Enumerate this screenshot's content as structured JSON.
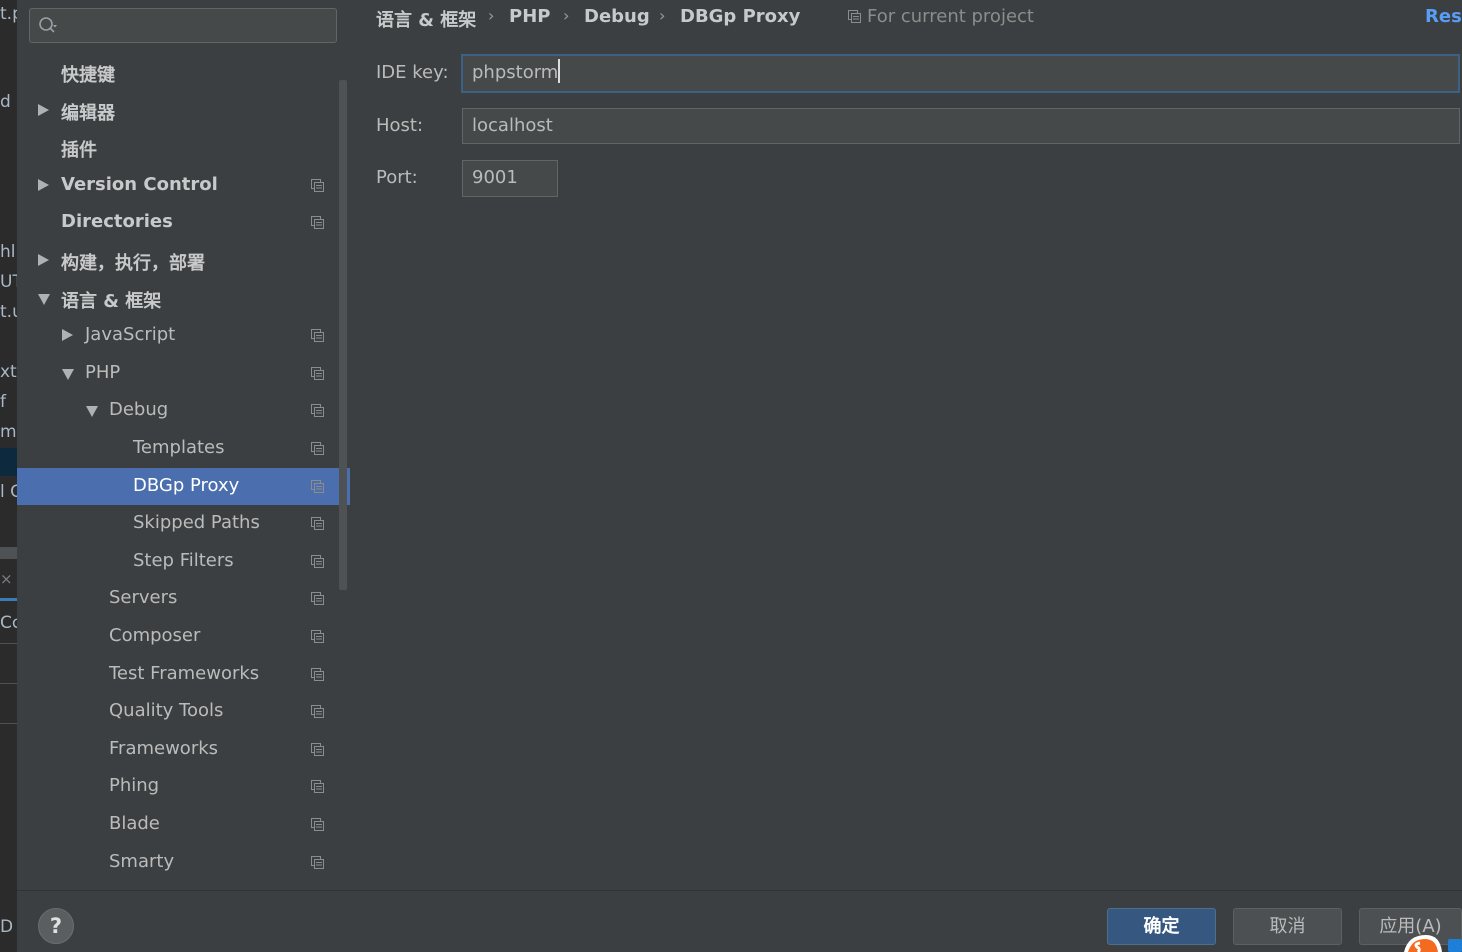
{
  "background_editor": {
    "fragments": [
      "t.p",
      "d",
      "hl",
      "UT",
      "t.u",
      "xt",
      "f",
      "mc",
      "l C",
      "Cc",
      "D"
    ]
  },
  "search": {
    "placeholder": "",
    "value": ""
  },
  "tree": [
    {
      "label": "快捷键",
      "bold": true,
      "arrow": "none",
      "level": 0,
      "project_icon": false,
      "selected": false
    },
    {
      "label": "编辑器",
      "bold": true,
      "arrow": "right",
      "level": 0,
      "project_icon": false,
      "selected": false
    },
    {
      "label": "插件",
      "bold": true,
      "arrow": "none",
      "level": 0,
      "project_icon": false,
      "selected": false
    },
    {
      "label": "Version Control",
      "bold": true,
      "arrow": "right",
      "level": 0,
      "project_icon": true,
      "selected": false
    },
    {
      "label": "Directories",
      "bold": true,
      "arrow": "none",
      "level": 0,
      "project_icon": true,
      "selected": false
    },
    {
      "label": "构建，执行，部署",
      "bold": true,
      "arrow": "right",
      "level": 0,
      "project_icon": false,
      "selected": false
    },
    {
      "label": "语言 & 框架",
      "bold": true,
      "arrow": "down",
      "level": 0,
      "project_icon": false,
      "selected": false
    },
    {
      "label": "JavaScript",
      "bold": false,
      "arrow": "right",
      "level": 1,
      "project_icon": true,
      "selected": false
    },
    {
      "label": "PHP",
      "bold": false,
      "arrow": "down",
      "level": 1,
      "project_icon": true,
      "selected": false
    },
    {
      "label": "Debug",
      "bold": false,
      "arrow": "down",
      "level": 2,
      "project_icon": true,
      "selected": false
    },
    {
      "label": "Templates",
      "bold": false,
      "arrow": "none",
      "level": 3,
      "project_icon": true,
      "selected": false
    },
    {
      "label": "DBGp Proxy",
      "bold": false,
      "arrow": "none",
      "level": 3,
      "project_icon": true,
      "selected": true
    },
    {
      "label": "Skipped Paths",
      "bold": false,
      "arrow": "none",
      "level": 3,
      "project_icon": true,
      "selected": false
    },
    {
      "label": "Step Filters",
      "bold": false,
      "arrow": "none",
      "level": 3,
      "project_icon": true,
      "selected": false
    },
    {
      "label": "Servers",
      "bold": false,
      "arrow": "none",
      "level": 2,
      "project_icon": true,
      "selected": false
    },
    {
      "label": "Composer",
      "bold": false,
      "arrow": "none",
      "level": 2,
      "project_icon": true,
      "selected": false
    },
    {
      "label": "Test Frameworks",
      "bold": false,
      "arrow": "none",
      "level": 2,
      "project_icon": true,
      "selected": false
    },
    {
      "label": "Quality Tools",
      "bold": false,
      "arrow": "none",
      "level": 2,
      "project_icon": true,
      "selected": false
    },
    {
      "label": "Frameworks",
      "bold": false,
      "arrow": "none",
      "level": 2,
      "project_icon": true,
      "selected": false
    },
    {
      "label": "Phing",
      "bold": false,
      "arrow": "none",
      "level": 2,
      "project_icon": true,
      "selected": false
    },
    {
      "label": "Blade",
      "bold": false,
      "arrow": "none",
      "level": 2,
      "project_icon": true,
      "selected": false
    },
    {
      "label": "Smarty",
      "bold": false,
      "arrow": "none",
      "level": 2,
      "project_icon": true,
      "selected": false
    }
  ],
  "breadcrumb": [
    "语言 & 框架",
    "PHP",
    "Debug",
    "DBGp Proxy"
  ],
  "scope_label": "For current project",
  "reset_label": "Reset",
  "form": {
    "ide_key_label": "IDE key:",
    "ide_key_value": "phpstorm",
    "host_label": "Host:",
    "host_value": "localhost",
    "port_label": "Port:",
    "port_value": "9001"
  },
  "buttons": {
    "help": "?",
    "ok": "确定",
    "cancel": "取消",
    "apply": "应用(A)"
  },
  "colors": {
    "background": "#3c3f41",
    "selection": "#4b6eaf",
    "link": "#589df6",
    "primary_button": "#365880"
  }
}
